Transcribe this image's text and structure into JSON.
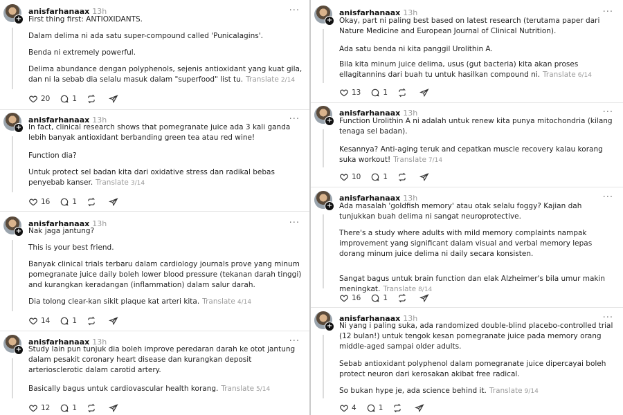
{
  "colors": {
    "text": "#222222",
    "muted": "#9a9a9a",
    "divider": "#e5e5e5",
    "thread": "#dcdcdc"
  },
  "icons": {
    "like": "heart-icon",
    "reply": "comment-icon",
    "repost": "repost-icon",
    "share": "send-icon",
    "more": "more-icon",
    "follow": "plus-icon"
  },
  "posts": [
    {
      "username": "anisfarhanaax",
      "time": "13h",
      "more": "···",
      "paragraphs": [
        "First thing first: ANTIOXIDANTS.",
        "Dalam delima ni ada satu super-compound called 'Punicalagins'.",
        "Benda ni extremely powerful.",
        "Delima abundance dengan polyphenols, sejenis antioxidant yang kuat gila, dan ni la sebab dia selalu masuk dalam \"superfood\" list tu."
      ],
      "translate": "Translate",
      "page": "2/14",
      "likes": "20",
      "replies": "1"
    },
    {
      "username": "anisfarhanaax",
      "time": "13h",
      "more": "···",
      "paragraphs": [
        "In fact, clinical research shows that pomegranate juice ada 3 kali ganda lebih banyak antioxidant berbanding green tea atau red wine!",
        "Function dia?",
        "Untuk protect sel badan kita dari oxidative stress dan radikal bebas penyebab kanser."
      ],
      "translate": "Translate",
      "page": "3/14",
      "likes": "16",
      "replies": "1"
    },
    {
      "username": "anisfarhanaax",
      "time": "13h",
      "more": "···",
      "paragraphs": [
        "Nak jaga jantung?",
        "This is your best friend.",
        "Banyak clinical trials terbaru dalam cardiology journals prove yang minum pomegranate juice daily boleh lower blood pressure (tekanan darah tinggi) and kurangkan keradangan (inflammation) dalam salur darah.",
        "Dia tolong clear-kan sikit plaque kat arteri kita."
      ],
      "translate": "Translate",
      "page": "4/14",
      "likes": "14",
      "replies": "1"
    },
    {
      "username": "anisfarhanaax",
      "time": "13h",
      "more": "···",
      "paragraphs": [
        "Study lain pun tunjuk dia boleh improve peredaran darah ke otot jantung dalam pesakit coronary heart disease dan kurangkan deposit arteriosclerotic dalam carotid artery.",
        "Basically bagus untuk cardiovascular health korang."
      ],
      "translate": "Translate",
      "page": "5/14",
      "likes": "12",
      "replies": "1"
    },
    {
      "username": "anisfarhanaax",
      "time": "13h",
      "more": "···",
      "paragraphs": [
        "Okay, part ni paling best based on latest research (terutama paper dari Nature Medicine and European Journal of Clinical Nutrition).",
        "Ada satu benda ni kita panggil Urolithin A.",
        "Bila kita minum juice delima, usus (gut bacteria) kita akan proses ellagitannins dari buah tu untuk hasilkan compound ni."
      ],
      "translate": "Translate",
      "page": "6/14",
      "likes": "13",
      "replies": "1"
    },
    {
      "username": "anisfarhanaax",
      "time": "13h",
      "more": "···",
      "paragraphs": [
        "Function Urolithin A ni adalah untuk renew kita punya mitochondria (kilang tenaga sel badan).",
        "Kesannya? Anti-aging teruk and cepatkan muscle recovery kalau korang suka workout!"
      ],
      "translate": "Translate",
      "page": "7/14",
      "likes": "10",
      "replies": "1"
    },
    {
      "username": "anisfarhanaax",
      "time": "13h",
      "more": "···",
      "paragraphs": [
        "Ada masalah 'goldfish memory' atau otak selalu foggy? Kajian dah tunjukkan buah delima ni sangat neuroprotective.",
        "There's a study where adults with mild memory complaints nampak improvement yang significant dalam visual and verbal memory lepas dorang minum juice delima ni daily secara konsisten.",
        "Sangat bagus untuk brain function dan elak Alzheimer's bila umur makin meningkat."
      ],
      "translate": "Translate",
      "page": "8/14",
      "likes": "16",
      "replies": "1"
    },
    {
      "username": "anisfarhanaax",
      "time": "13h",
      "more": "···",
      "paragraphs": [
        "Ni yang i paling suka, ada randomized double-blind placebo-controlled trial (12 bulan!) untuk tengok kesan pomegranate juice pada memory orang middle-aged sampai older adults.",
        "Sebab antioxidant polyphenol dalam pomegranate juice dipercayai boleh protect neuron dari kerosakan akibat free radical.",
        "So bukan hype je, ada science behind it."
      ],
      "translate": "Translate",
      "page": "9/14",
      "likes": "4",
      "replies": "1"
    }
  ]
}
